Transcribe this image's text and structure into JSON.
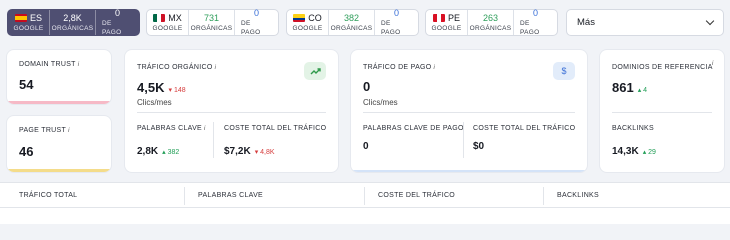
{
  "countries": [
    {
      "code": "ES",
      "value": "2,8K",
      "value_label": "ORGÁNICAS",
      "paid": "0",
      "paid_label": "DE PAGO",
      "engine": "GOOGLE"
    },
    {
      "code": "MX",
      "value": "731",
      "value_label": "ORGÁNICAS",
      "paid": "0",
      "paid_label": "DE PAGO",
      "engine": "GOOGLE"
    },
    {
      "code": "CO",
      "value": "382",
      "value_label": "ORGÁNICAS",
      "paid": "0",
      "paid_label": "DE PAGO",
      "engine": "GOOGLE"
    },
    {
      "code": "PE",
      "value": "263",
      "value_label": "ORGÁNICAS",
      "paid": "0",
      "paid_label": "DE PAGO",
      "engine": "GOOGLE"
    }
  ],
  "more_label": "Más",
  "domain_trust": {
    "label": "DOMAIN TRUST",
    "info": "i",
    "value": "54",
    "color": "#f6b9c6"
  },
  "page_trust": {
    "label": "PAGE TRUST",
    "info": "i",
    "value": "46",
    "color": "#f4dc8a"
  },
  "organic": {
    "label": "TRÁFICO ORGÁNICO",
    "info": "i",
    "value": "4,5K",
    "delta": "148",
    "delta_dir": "down",
    "unit": "Clics/mes",
    "keywords_label": "PALABRAS CLAVE",
    "keywords_value": "2,8K",
    "keywords_delta": "382",
    "cost_label": "COSTE TOTAL DEL TRÁFICO",
    "cost_value": "$7,2K",
    "cost_delta": "4,8K",
    "icon": "organic-traffic-icon",
    "icon_bg": "#e3f3e6",
    "icon_color": "#2f9a4a"
  },
  "paid": {
    "label": "TRÁFICO DE PAGO",
    "info": "i",
    "value": "0",
    "unit": "Clics/mes",
    "keywords_label": "PALABRAS CLAVE DE PAGO",
    "keywords_value": "0",
    "cost_label": "COSTE TOTAL DEL TRÁFICO",
    "cost_value": "$0",
    "icon": "dollar-icon",
    "icon_glyph": "$",
    "icon_bg": "#e2ecfa",
    "icon_color": "#3b6fd6",
    "bar_color": "#d4e3f8"
  },
  "referring": {
    "label": "DOMINIOS DE REFERENCIA",
    "info": "i",
    "value": "861",
    "delta": "4",
    "backlinks_label": "BACKLINKS",
    "backlinks_value": "14,3K",
    "backlinks_delta": "29"
  },
  "tabs": [
    "TRÁFICO TOTAL",
    "PALABRAS CLAVE",
    "COSTE DEL TRÁFICO",
    "BACKLINKS"
  ]
}
